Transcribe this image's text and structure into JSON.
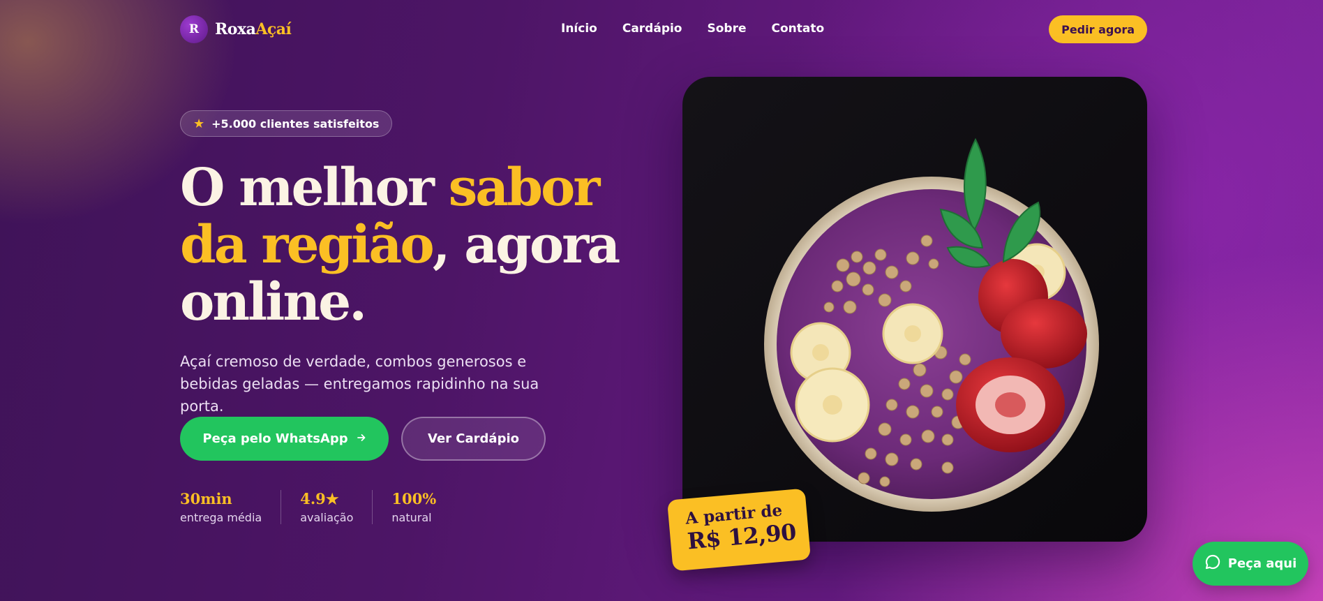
{
  "brand": {
    "mark": "R",
    "name_part1": "Roxa",
    "name_part2": "Açaí"
  },
  "nav": {
    "links": [
      "Início",
      "Cardápio",
      "Sobre",
      "Contato"
    ],
    "cta": "Pedir agora"
  },
  "hero": {
    "badge": "+5.000 clientes satisfeitos",
    "headline": {
      "part1": "O melhor ",
      "highlight1": "sabor",
      "highlight2": "da região",
      "part2": ", agora",
      "part3": "online."
    },
    "subtitle": "Açaí cremoso de verdade, combos generosos e bebidas geladas — entregamos rapidinho na sua porta.",
    "primary_cta": "Peça pelo WhatsApp",
    "secondary_cta": "Ver Cardápio",
    "stats": [
      {
        "value": "30min",
        "label": "entrega média"
      },
      {
        "value": "4.9★",
        "label": "avaliação"
      },
      {
        "value": "100%",
        "label": "natural"
      }
    ]
  },
  "price_tag": {
    "prefix": "A partir de",
    "price": "R$ 12,90"
  },
  "floating_cta": "Peça aqui",
  "colors": {
    "accent": "#fbbf24",
    "whatsapp": "#22c55e",
    "background": "#4d1566"
  }
}
